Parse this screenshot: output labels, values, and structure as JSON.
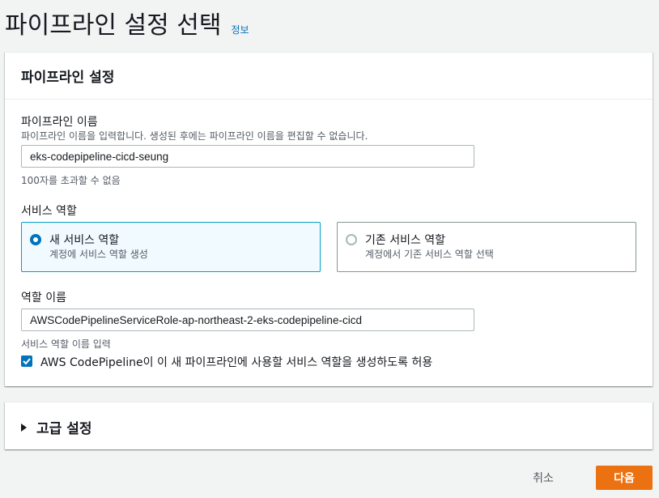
{
  "page": {
    "title": "파이프라인 설정 선택",
    "info_link": "정보"
  },
  "settings_panel": {
    "header": "파이프라인 설정",
    "pipeline_name": {
      "label": "파이프라인 이름",
      "description": "파이프라인 이름을 입력합니다. 생성된 후에는 파이프라인 이름을 편집할 수 없습니다.",
      "value": "eks-codepipeline-cicd-seung",
      "constraint": "100자를 초과할 수 없음"
    },
    "service_role": {
      "label": "서비스 역할",
      "options": [
        {
          "title": "새 서비스 역할",
          "description": "계정에 서비스 역할 생성",
          "selected": true
        },
        {
          "title": "기존 서비스 역할",
          "description": "계정에서 기존 서비스 역할 선택",
          "selected": false
        }
      ]
    },
    "role_name": {
      "label": "역할 이름",
      "value": "AWSCodePipelineServiceRole-ap-northeast-2-eks-codepipeline-cicd",
      "description": "서비스 역할 이름 입력"
    },
    "allow_checkbox": {
      "label": "AWS CodePipeline이 이 새 파이프라인에 사용할 서비스 역할을 생성하도록 허용",
      "checked": true
    }
  },
  "advanced_panel": {
    "header": "고급 설정"
  },
  "actions": {
    "cancel_label": "취소",
    "next_label": "다음"
  },
  "colors": {
    "accent": "#0073bb",
    "primary_button": "#ec7211",
    "selected_tile_border": "#00a1c9"
  }
}
